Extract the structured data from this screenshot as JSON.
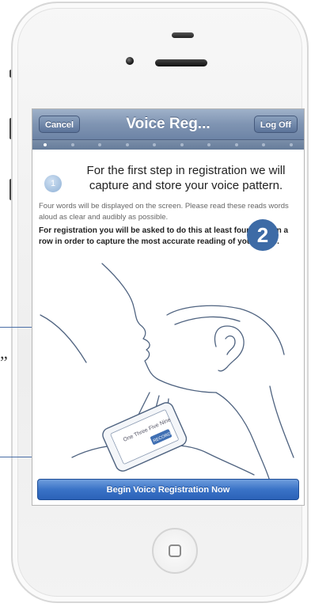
{
  "navbar": {
    "title": "Voice Reg...",
    "cancel_label": "Cancel",
    "logoff_label": "Log Off"
  },
  "progress": {
    "total_steps": 10,
    "current_step": 1
  },
  "step": {
    "number": "1",
    "title": "For the first step in registration we will capture and store your voice pattern.",
    "intro": "Four words will be displayed on the screen. Please read these reads words aloud as clear and audibly as possible.",
    "bold_note": "For registration you will be asked to do this at least four times in a row in order to capture the most accurate reading of your voice."
  },
  "illustration": {
    "phone_text": "One Three Five Nine",
    "phone_button": "RECORD",
    "badge_number": "2"
  },
  "begin_button_label": "Begin Voice Registration Now",
  "background_quote": "”",
  "colors": {
    "navbar": "#7f94b2",
    "primary_button": "#3a73c7",
    "badge": "#3d6ba6"
  }
}
